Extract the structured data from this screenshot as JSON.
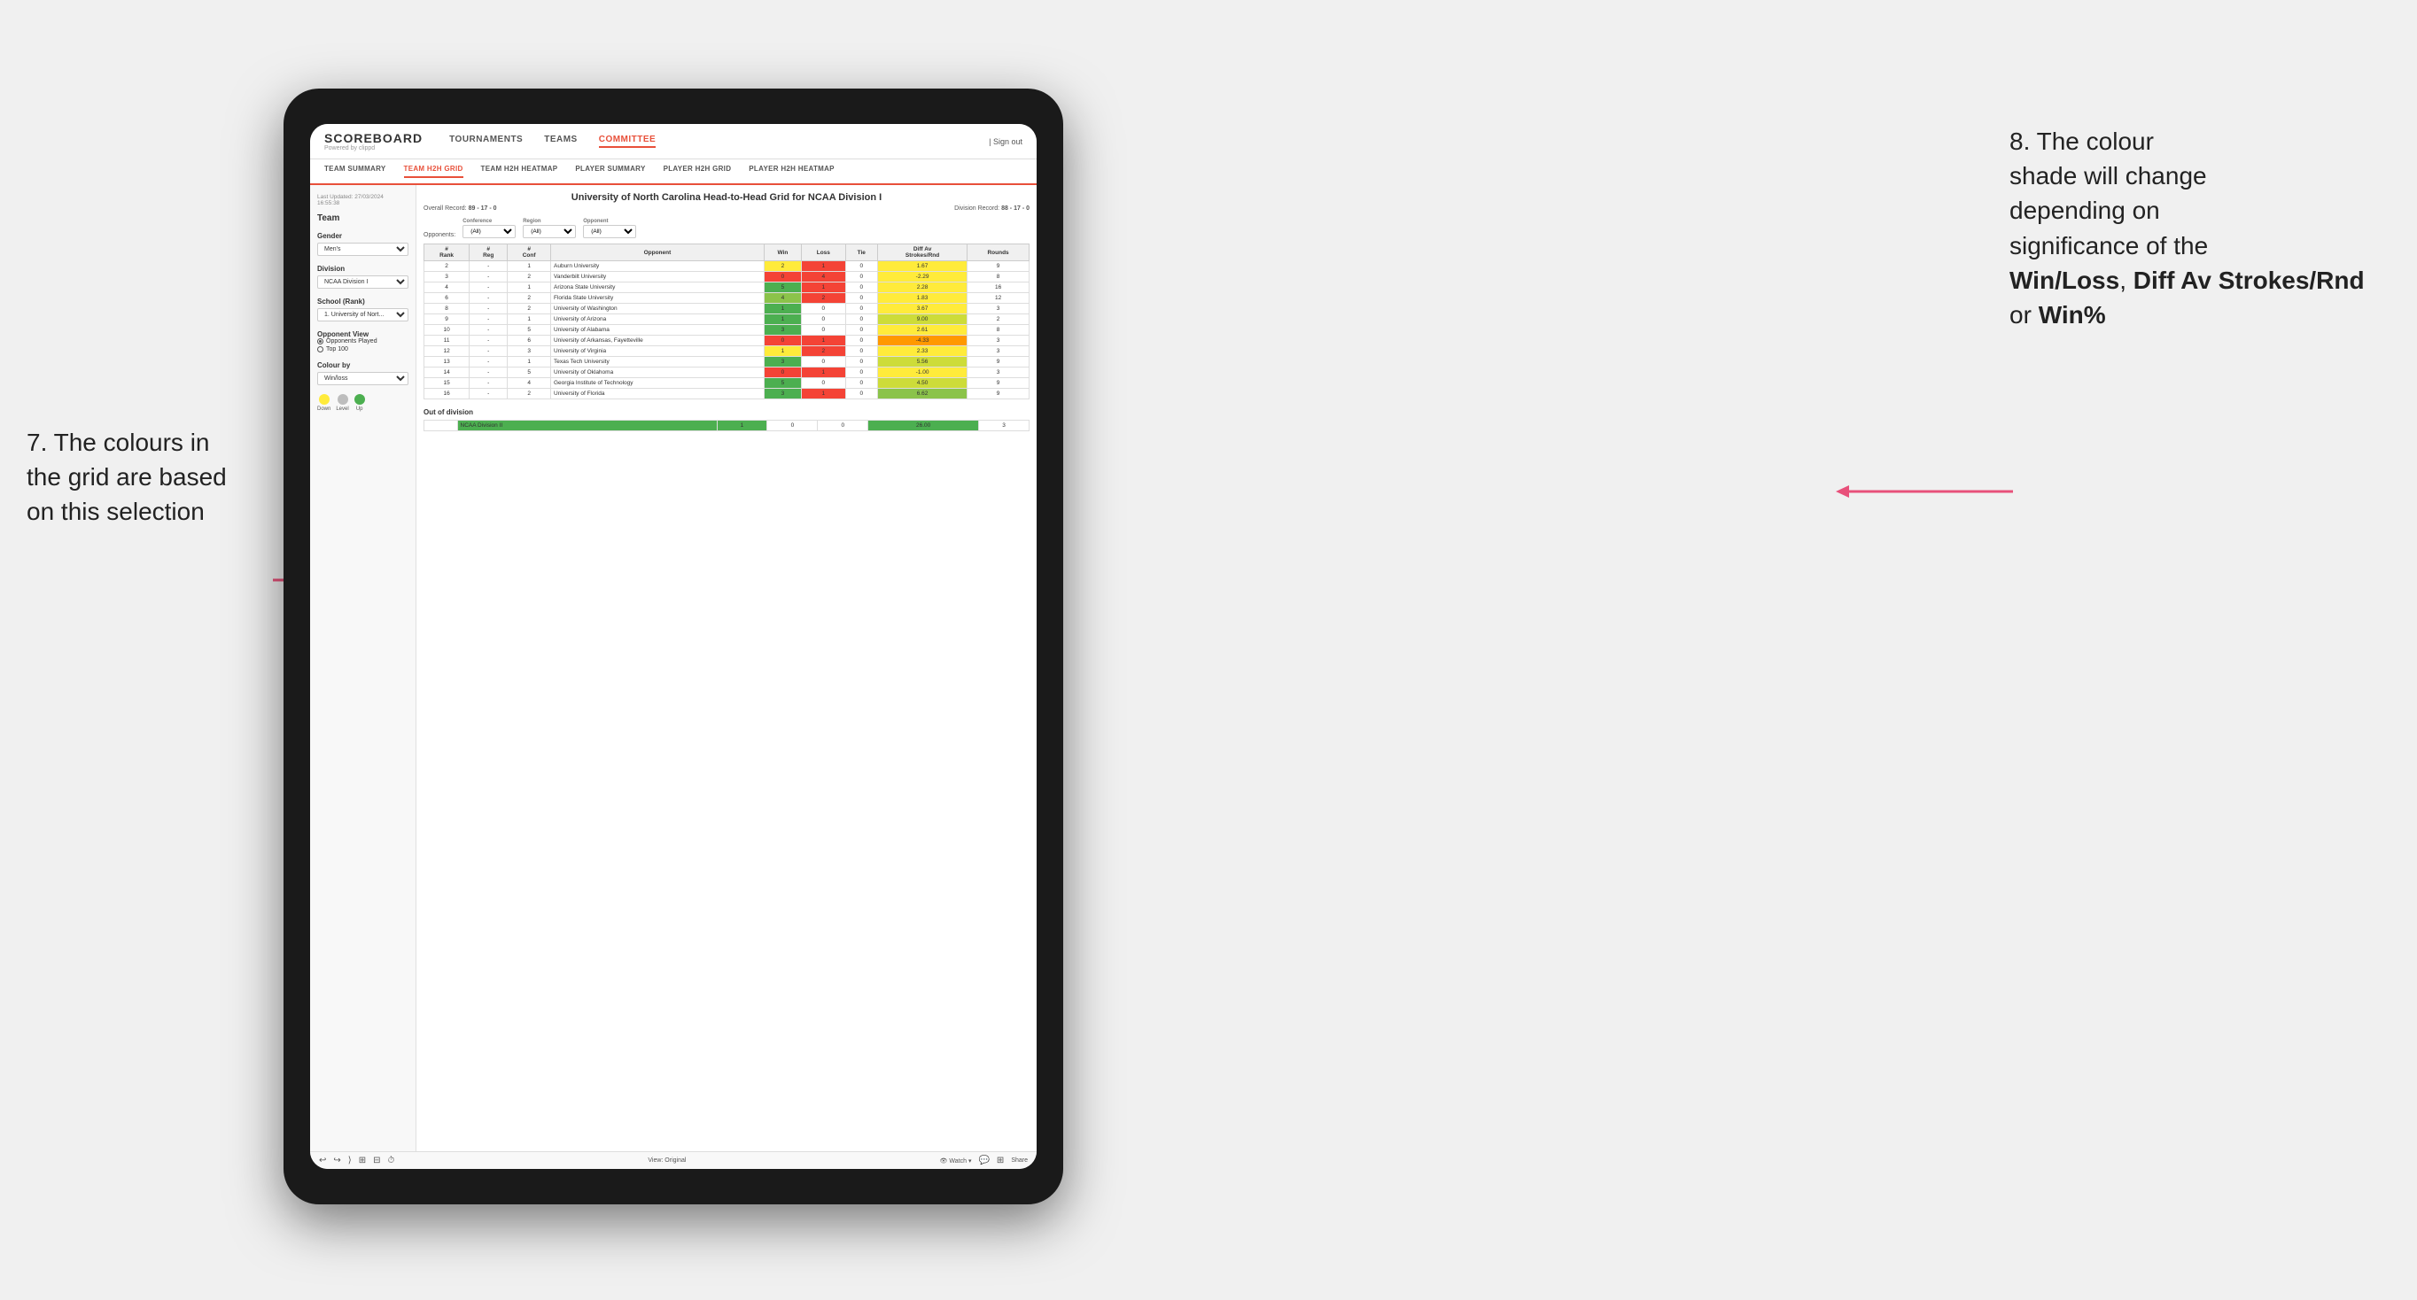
{
  "annotations": {
    "left": {
      "line1": "7. The colours in",
      "line2": "the grid are based",
      "line3": "on this selection"
    },
    "right": {
      "line1": "8. The colour",
      "line2": "shade will change",
      "line3": "depending on",
      "line4": "significance of the",
      "bold1": "Win/Loss",
      "comma1": ", ",
      "bold2": "Diff Av Strokes/Rnd",
      "or_text": " or ",
      "bold3": "Win%"
    }
  },
  "nav": {
    "logo": "SCOREBOARD",
    "logo_sub": "Powered by clippd",
    "items": [
      "TOURNAMENTS",
      "TEAMS",
      "COMMITTEE"
    ],
    "active_item": "COMMITTEE",
    "sign_out": "| Sign out"
  },
  "sub_nav": {
    "items": [
      "TEAM SUMMARY",
      "TEAM H2H GRID",
      "TEAM H2H HEATMAP",
      "PLAYER SUMMARY",
      "PLAYER H2H GRID",
      "PLAYER H2H HEATMAP"
    ],
    "active_item": "TEAM H2H GRID"
  },
  "sidebar": {
    "timestamp": "Last Updated: 27/03/2024",
    "timestamp2": "16:55:38",
    "team_label": "Team",
    "gender_label": "Gender",
    "gender_value": "Men's",
    "division_label": "Division",
    "division_value": "NCAA Division I",
    "school_label": "School (Rank)",
    "school_value": "1. University of Nort...",
    "opponent_view_label": "Opponent View",
    "radio1": "Opponents Played",
    "radio2": "Top 100",
    "colour_by_label": "Colour by",
    "colour_by_value": "Win/loss",
    "legend": {
      "down_label": "Down",
      "level_label": "Level",
      "up_label": "Up"
    }
  },
  "grid": {
    "title": "University of North Carolina Head-to-Head Grid for NCAA Division I",
    "overall_record_label": "Overall Record:",
    "overall_record": "89 - 17 - 0",
    "division_record_label": "Division Record:",
    "division_record": "88 - 17 - 0",
    "filters": {
      "conference_label": "Conference",
      "conference_value": "(All)",
      "region_label": "Region",
      "region_value": "(All)",
      "opponent_label": "Opponent",
      "opponent_value": "(All)",
      "opponents_label": "Opponents:"
    },
    "columns": [
      "#\nRank",
      "#\nReg",
      "#\nConf",
      "Opponent",
      "Win",
      "Loss",
      "Tie",
      "Diff Av\nStrokes/Rnd",
      "Rounds"
    ],
    "rows": [
      {
        "rank": "2",
        "reg": "-",
        "conf": "1",
        "opponent": "Auburn University",
        "win": "2",
        "loss": "1",
        "tie": "0",
        "diff": "1.67",
        "rounds": "9",
        "win_color": "cell-yellow",
        "diff_color": "cell-yellow"
      },
      {
        "rank": "3",
        "reg": "-",
        "conf": "2",
        "opponent": "Vanderbilt University",
        "win": "0",
        "loss": "4",
        "tie": "0",
        "diff": "-2.29",
        "rounds": "8",
        "win_color": "cell-red",
        "diff_color": "cell-yellow"
      },
      {
        "rank": "4",
        "reg": "-",
        "conf": "1",
        "opponent": "Arizona State University",
        "win": "5",
        "loss": "1",
        "tie": "0",
        "diff": "2.28",
        "rounds": "16",
        "win_color": "cell-green-dark",
        "diff_color": "cell-yellow"
      },
      {
        "rank": "6",
        "reg": "-",
        "conf": "2",
        "opponent": "Florida State University",
        "win": "4",
        "loss": "2",
        "tie": "0",
        "diff": "1.83",
        "rounds": "12",
        "win_color": "cell-green-mid",
        "diff_color": "cell-yellow"
      },
      {
        "rank": "8",
        "reg": "-",
        "conf": "2",
        "opponent": "University of Washington",
        "win": "1",
        "loss": "0",
        "tie": "0",
        "diff": "3.67",
        "rounds": "3",
        "win_color": "cell-green-dark",
        "diff_color": "cell-yellow"
      },
      {
        "rank": "9",
        "reg": "-",
        "conf": "1",
        "opponent": "University of Arizona",
        "win": "1",
        "loss": "0",
        "tie": "0",
        "diff": "9.00",
        "rounds": "2",
        "win_color": "cell-green-dark",
        "diff_color": "cell-green-light"
      },
      {
        "rank": "10",
        "reg": "-",
        "conf": "5",
        "opponent": "University of Alabama",
        "win": "3",
        "loss": "0",
        "tie": "0",
        "diff": "2.61",
        "rounds": "8",
        "win_color": "cell-green-dark",
        "diff_color": "cell-yellow"
      },
      {
        "rank": "11",
        "reg": "-",
        "conf": "6",
        "opponent": "University of Arkansas, Fayetteville",
        "win": "0",
        "loss": "1",
        "tie": "0",
        "diff": "-4.33",
        "rounds": "3",
        "win_color": "cell-red",
        "diff_color": "cell-orange"
      },
      {
        "rank": "12",
        "reg": "-",
        "conf": "3",
        "opponent": "University of Virginia",
        "win": "1",
        "loss": "2",
        "tie": "0",
        "diff": "2.33",
        "rounds": "3",
        "win_color": "cell-yellow",
        "diff_color": "cell-yellow"
      },
      {
        "rank": "13",
        "reg": "-",
        "conf": "1",
        "opponent": "Texas Tech University",
        "win": "3",
        "loss": "0",
        "tie": "0",
        "diff": "5.56",
        "rounds": "9",
        "win_color": "cell-green-dark",
        "diff_color": "cell-green-light"
      },
      {
        "rank": "14",
        "reg": "-",
        "conf": "5",
        "opponent": "University of Oklahoma",
        "win": "0",
        "loss": "1",
        "tie": "0",
        "diff": "-1.00",
        "rounds": "3",
        "win_color": "cell-red",
        "diff_color": "cell-yellow"
      },
      {
        "rank": "15",
        "reg": "-",
        "conf": "4",
        "opponent": "Georgia Institute of Technology",
        "win": "5",
        "loss": "0",
        "tie": "0",
        "diff": "4.50",
        "rounds": "9",
        "win_color": "cell-green-dark",
        "diff_color": "cell-green-light"
      },
      {
        "rank": "16",
        "reg": "-",
        "conf": "2",
        "opponent": "University of Florida",
        "win": "3",
        "loss": "1",
        "tie": "0",
        "diff": "6.62",
        "rounds": "9",
        "win_color": "cell-green-dark",
        "diff_color": "cell-green-mid"
      }
    ],
    "out_of_division_label": "Out of division",
    "out_of_division_rows": [
      {
        "division": "NCAA Division II",
        "win": "1",
        "loss": "0",
        "tie": "0",
        "diff": "26.00",
        "rounds": "3",
        "win_color": "cell-green-dark",
        "diff_color": "cell-green-dark"
      }
    ]
  },
  "toolbar": {
    "view_label": "View: Original",
    "watch_label": "Watch ▾",
    "share_label": "Share"
  }
}
